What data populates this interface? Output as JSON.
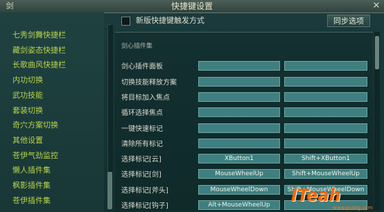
{
  "window": {
    "title": "快捷键设置",
    "corner_logo": "剑"
  },
  "left_panel": {
    "items": [
      {
        "label": "七秀剑舞快捷栏"
      },
      {
        "label": "藏剑姿态快捷栏"
      },
      {
        "label": "长歌曲风快捷栏"
      },
      {
        "label": "内功切换"
      },
      {
        "label": "武功技能"
      },
      {
        "label": "套装切换"
      },
      {
        "label": "奇穴方案切换"
      },
      {
        "label": "其他设置"
      },
      {
        "label": "苍伊气劲监控"
      },
      {
        "label": "懒人插件集"
      },
      {
        "label": "枫影插件集"
      },
      {
        "label": "苍伊插件集"
      }
    ]
  },
  "options": {
    "checkbox_label": "新版快捷键触发方式",
    "sync_button": "同步选项"
  },
  "bindings": {
    "rows": [
      {
        "label": "剑心插件集",
        "primary": "",
        "secondary": ""
      },
      {
        "label": "剑心插件面板",
        "primary": "",
        "secondary": ""
      },
      {
        "label": "切换技能释放方案",
        "primary": "",
        "secondary": ""
      },
      {
        "label": "将目标加入焦点",
        "primary": "",
        "secondary": ""
      },
      {
        "label": "循环选择焦点",
        "primary": "",
        "secondary": ""
      },
      {
        "label": "一键快速标记",
        "primary": "",
        "secondary": ""
      },
      {
        "label": "清除所有标记",
        "primary": "",
        "secondary": ""
      },
      {
        "label": "选择标记[云]",
        "primary": "XButton1",
        "secondary": "Shift+XButton1"
      },
      {
        "label": "选择标记[剑]",
        "primary": "MouseWheelUp",
        "secondary": "Shift+MouseWheelUp"
      },
      {
        "label": "选择标记[斧头]",
        "primary": "MouseWheelDown",
        "secondary": "Shift+MouseWheelDown"
      },
      {
        "label": "选择标记[钩子]",
        "primary": "Alt+MouseWheelUp",
        "secondary": ""
      }
    ]
  },
  "watermark": {
    "brand": "ITeah",
    "domain": "www.pcdog.com"
  },
  "colors": {
    "left_item": "#b9d34a",
    "slot_bg": "#3f7f80",
    "watermark": "#ff6600"
  }
}
